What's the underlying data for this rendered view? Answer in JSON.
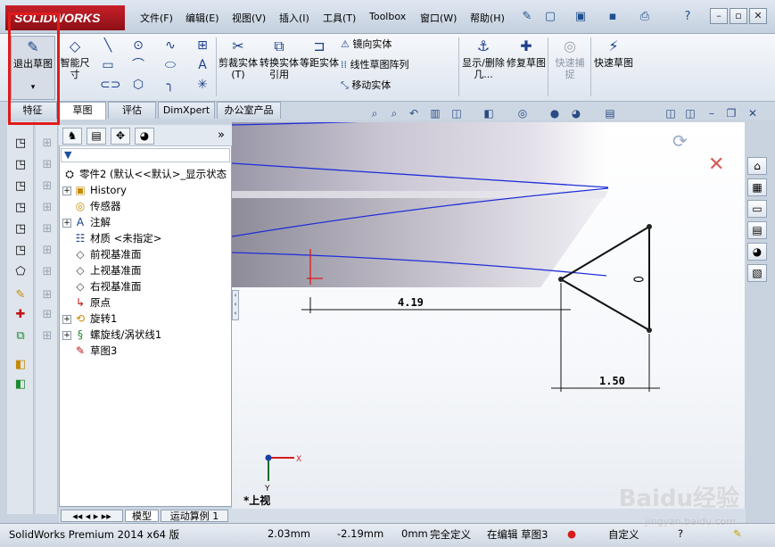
{
  "app": {
    "logo_text": "SOLIDWORKS",
    "brand_color": "#c8202a"
  },
  "menu": [
    "文件(F)",
    "编辑(E)",
    "视图(V)",
    "插入(I)",
    "工具(T)",
    "Toolbox",
    "窗口(W)",
    "帮助(H)"
  ],
  "command_manager": {
    "exit_sketch": "退出草图",
    "smart_dimension": "智能尺寸",
    "trim_entities": "剪裁实体(T)",
    "convert_entities": "转换实体引用",
    "offset_entities": "等距实体",
    "mirror_entities": "镜向实体",
    "linear_pattern": "线性草图阵列",
    "move_entities": "移动实体",
    "show_delete": "显示/删除几...",
    "repair_sketch": "修复草图",
    "quick_snaps": "快速捕捉",
    "rapid_sketch": "快速草图"
  },
  "tabs": [
    "特征",
    "草图",
    "评估",
    "DimXpert",
    "办公室产品"
  ],
  "active_tab": "草图",
  "feature_tree": {
    "root": "零件2 (默认<<默认>_显示状态",
    "items": [
      {
        "label": "History",
        "icon": "history-icon",
        "expandable": true
      },
      {
        "label": "传感器",
        "icon": "sensor-icon",
        "expandable": false
      },
      {
        "label": "注解",
        "icon": "annotation-icon",
        "expandable": true
      },
      {
        "label": "材质 <未指定>",
        "icon": "material-icon",
        "expandable": false
      },
      {
        "label": "前视基准面",
        "icon": "plane-icon",
        "expandable": false
      },
      {
        "label": "上视基准面",
        "icon": "plane-icon",
        "expandable": false
      },
      {
        "label": "右视基准面",
        "icon": "plane-icon",
        "expandable": false
      },
      {
        "label": "原点",
        "icon": "origin-icon",
        "expandable": false
      },
      {
        "label": "旋转1",
        "icon": "revolve-icon",
        "expandable": true
      },
      {
        "label": "螺旋线/涡状线1",
        "icon": "helix-icon",
        "expandable": true
      },
      {
        "label": "草图3",
        "icon": "sketch-icon",
        "expandable": false
      }
    ]
  },
  "graphics": {
    "dim_horizontal": "4.19",
    "dim_side": "1.50",
    "view_label": "*上视",
    "axis_x": "X",
    "axis_y": "Y",
    "sketch_color": "#1a1a1a",
    "helix_color": "#1f2fd8"
  },
  "bottom_tabs": [
    "模型",
    "运动算例 1"
  ],
  "status": {
    "product": "SolidWorks Premium 2014 x64 版",
    "x": "2.03mm",
    "y": "-2.19mm",
    "z": "0mm",
    "defined": "完全定义",
    "editing": "在编辑 草图3",
    "units": "自定义"
  },
  "watermark": {
    "text": "Baidu经验",
    "url": "jingyan.baidu.com"
  }
}
